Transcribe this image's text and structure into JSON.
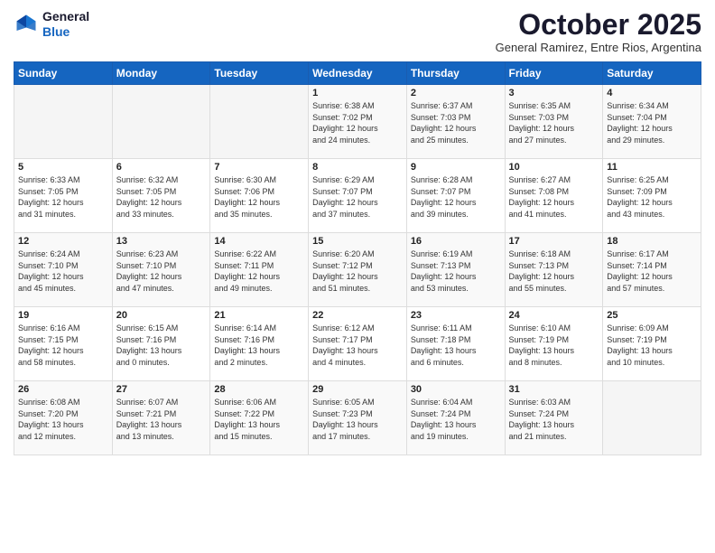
{
  "header": {
    "logo_general": "General",
    "logo_blue": "Blue",
    "month": "October 2025",
    "location": "General Ramirez, Entre Rios, Argentina"
  },
  "days_of_week": [
    "Sunday",
    "Monday",
    "Tuesday",
    "Wednesday",
    "Thursday",
    "Friday",
    "Saturday"
  ],
  "weeks": [
    [
      {
        "num": "",
        "info": ""
      },
      {
        "num": "",
        "info": ""
      },
      {
        "num": "",
        "info": ""
      },
      {
        "num": "1",
        "info": "Sunrise: 6:38 AM\nSunset: 7:02 PM\nDaylight: 12 hours\nand 24 minutes."
      },
      {
        "num": "2",
        "info": "Sunrise: 6:37 AM\nSunset: 7:03 PM\nDaylight: 12 hours\nand 25 minutes."
      },
      {
        "num": "3",
        "info": "Sunrise: 6:35 AM\nSunset: 7:03 PM\nDaylight: 12 hours\nand 27 minutes."
      },
      {
        "num": "4",
        "info": "Sunrise: 6:34 AM\nSunset: 7:04 PM\nDaylight: 12 hours\nand 29 minutes."
      }
    ],
    [
      {
        "num": "5",
        "info": "Sunrise: 6:33 AM\nSunset: 7:05 PM\nDaylight: 12 hours\nand 31 minutes."
      },
      {
        "num": "6",
        "info": "Sunrise: 6:32 AM\nSunset: 7:05 PM\nDaylight: 12 hours\nand 33 minutes."
      },
      {
        "num": "7",
        "info": "Sunrise: 6:30 AM\nSunset: 7:06 PM\nDaylight: 12 hours\nand 35 minutes."
      },
      {
        "num": "8",
        "info": "Sunrise: 6:29 AM\nSunset: 7:07 PM\nDaylight: 12 hours\nand 37 minutes."
      },
      {
        "num": "9",
        "info": "Sunrise: 6:28 AM\nSunset: 7:07 PM\nDaylight: 12 hours\nand 39 minutes."
      },
      {
        "num": "10",
        "info": "Sunrise: 6:27 AM\nSunset: 7:08 PM\nDaylight: 12 hours\nand 41 minutes."
      },
      {
        "num": "11",
        "info": "Sunrise: 6:25 AM\nSunset: 7:09 PM\nDaylight: 12 hours\nand 43 minutes."
      }
    ],
    [
      {
        "num": "12",
        "info": "Sunrise: 6:24 AM\nSunset: 7:10 PM\nDaylight: 12 hours\nand 45 minutes."
      },
      {
        "num": "13",
        "info": "Sunrise: 6:23 AM\nSunset: 7:10 PM\nDaylight: 12 hours\nand 47 minutes."
      },
      {
        "num": "14",
        "info": "Sunrise: 6:22 AM\nSunset: 7:11 PM\nDaylight: 12 hours\nand 49 minutes."
      },
      {
        "num": "15",
        "info": "Sunrise: 6:20 AM\nSunset: 7:12 PM\nDaylight: 12 hours\nand 51 minutes."
      },
      {
        "num": "16",
        "info": "Sunrise: 6:19 AM\nSunset: 7:13 PM\nDaylight: 12 hours\nand 53 minutes."
      },
      {
        "num": "17",
        "info": "Sunrise: 6:18 AM\nSunset: 7:13 PM\nDaylight: 12 hours\nand 55 minutes."
      },
      {
        "num": "18",
        "info": "Sunrise: 6:17 AM\nSunset: 7:14 PM\nDaylight: 12 hours\nand 57 minutes."
      }
    ],
    [
      {
        "num": "19",
        "info": "Sunrise: 6:16 AM\nSunset: 7:15 PM\nDaylight: 12 hours\nand 58 minutes."
      },
      {
        "num": "20",
        "info": "Sunrise: 6:15 AM\nSunset: 7:16 PM\nDaylight: 13 hours\nand 0 minutes."
      },
      {
        "num": "21",
        "info": "Sunrise: 6:14 AM\nSunset: 7:16 PM\nDaylight: 13 hours\nand 2 minutes."
      },
      {
        "num": "22",
        "info": "Sunrise: 6:12 AM\nSunset: 7:17 PM\nDaylight: 13 hours\nand 4 minutes."
      },
      {
        "num": "23",
        "info": "Sunrise: 6:11 AM\nSunset: 7:18 PM\nDaylight: 13 hours\nand 6 minutes."
      },
      {
        "num": "24",
        "info": "Sunrise: 6:10 AM\nSunset: 7:19 PM\nDaylight: 13 hours\nand 8 minutes."
      },
      {
        "num": "25",
        "info": "Sunrise: 6:09 AM\nSunset: 7:19 PM\nDaylight: 13 hours\nand 10 minutes."
      }
    ],
    [
      {
        "num": "26",
        "info": "Sunrise: 6:08 AM\nSunset: 7:20 PM\nDaylight: 13 hours\nand 12 minutes."
      },
      {
        "num": "27",
        "info": "Sunrise: 6:07 AM\nSunset: 7:21 PM\nDaylight: 13 hours\nand 13 minutes."
      },
      {
        "num": "28",
        "info": "Sunrise: 6:06 AM\nSunset: 7:22 PM\nDaylight: 13 hours\nand 15 minutes."
      },
      {
        "num": "29",
        "info": "Sunrise: 6:05 AM\nSunset: 7:23 PM\nDaylight: 13 hours\nand 17 minutes."
      },
      {
        "num": "30",
        "info": "Sunrise: 6:04 AM\nSunset: 7:24 PM\nDaylight: 13 hours\nand 19 minutes."
      },
      {
        "num": "31",
        "info": "Sunrise: 6:03 AM\nSunset: 7:24 PM\nDaylight: 13 hours\nand 21 minutes."
      },
      {
        "num": "",
        "info": ""
      }
    ]
  ]
}
